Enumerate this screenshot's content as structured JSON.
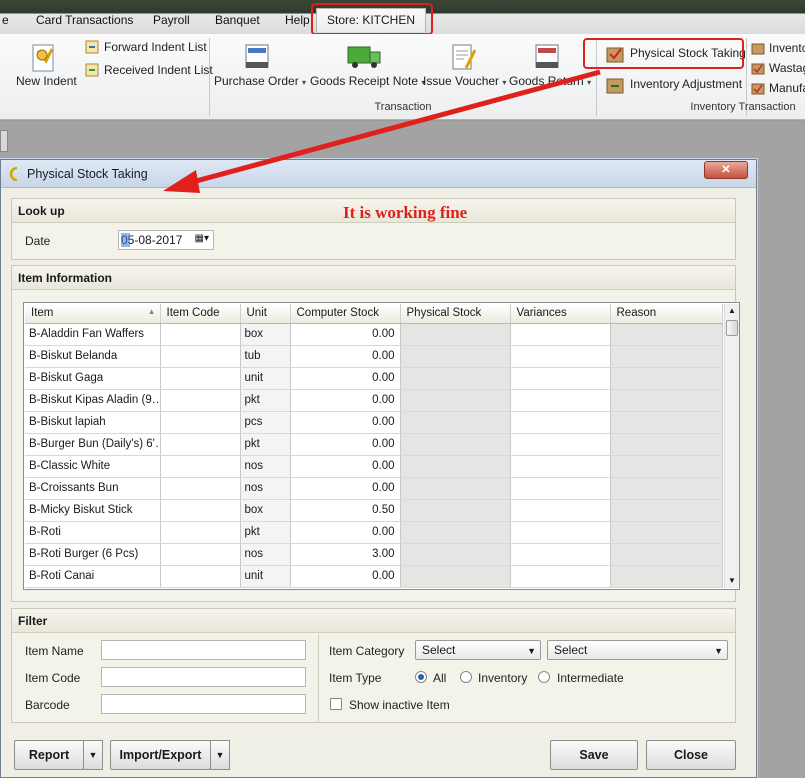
{
  "menu": {
    "tabs": [
      "e",
      "Card Transactions",
      "Payroll",
      "Banquet",
      "Help"
    ],
    "store_tab": "Store: KITCHEN"
  },
  "ribbon": {
    "new_indent": "New Indent",
    "forward_indent_list": "Forward Indent List",
    "received_indent_list": "Received Indent List",
    "purchase_order": "Purchase Order",
    "goods_receipt_note": "Goods Receipt Note",
    "issue_voucher": "Issue Voucher",
    "goods_return": "Goods Return",
    "group_transaction": "Transaction",
    "physical_stock_taking": "Physical Stock Taking",
    "inventory_adjustment": "Inventory Adjustment",
    "invento": "Invento",
    "wastag": "Wastag",
    "manufa": "Manufa",
    "group_inventory_transaction": "Inventory Transaction"
  },
  "annotation": "It is working fine",
  "dialog": {
    "title": "Physical Stock Taking",
    "lookup_title": "Look up",
    "date_label": "Date",
    "date_value": "05-08-2017",
    "item_info_title": "Item Information",
    "columns": [
      "Item",
      "Item Code",
      "Unit",
      "Computer Stock",
      "Physical Stock",
      "Variances",
      "Reason"
    ],
    "rows": [
      {
        "item": "B-Aladdin Fan Waffers",
        "code": "",
        "unit": "box",
        "stock": "0.00"
      },
      {
        "item": "B-Biskut Belanda",
        "code": "",
        "unit": "tub",
        "stock": "0.00"
      },
      {
        "item": "B-Biskut Gaga",
        "code": "",
        "unit": "unit",
        "stock": "0.00"
      },
      {
        "item": "B-Biskut Kipas Aladin (9…",
        "code": "",
        "unit": "pkt",
        "stock": "0.00"
      },
      {
        "item": "B-Biskut lapiah",
        "code": "",
        "unit": "pcs",
        "stock": "0.00"
      },
      {
        "item": "B-Burger Bun (Daily's) 6'…",
        "code": "",
        "unit": "pkt",
        "stock": "0.00"
      },
      {
        "item": "B-Classic White",
        "code": "",
        "unit": "nos",
        "stock": "0.00"
      },
      {
        "item": "B-Croissants Bun",
        "code": "",
        "unit": "nos",
        "stock": "0.00"
      },
      {
        "item": "B-Micky Biskut Stick",
        "code": "",
        "unit": "box",
        "stock": "0.50"
      },
      {
        "item": "B-Roti",
        "code": "",
        "unit": "pkt",
        "stock": "0.00"
      },
      {
        "item": "B-Roti Burger (6 Pcs)",
        "code": "",
        "unit": "nos",
        "stock": "3.00"
      },
      {
        "item": "B-Roti Canai",
        "code": "",
        "unit": "unit",
        "stock": "0.00"
      }
    ],
    "filter_title": "Filter",
    "item_name_label": "Item Name",
    "item_code_label": "Item Code",
    "barcode_label": "Barcode",
    "item_category_label": "Item Category",
    "category_select1": "Select",
    "category_select2": "Select",
    "item_type_label": "Item Type",
    "type_all": "All",
    "type_inventory": "Inventory",
    "type_intermediate": "Intermediate",
    "show_inactive": "Show inactive Item",
    "report": "Report",
    "import_export": "Import/Export",
    "save": "Save",
    "close": "Close"
  },
  "colors": {
    "highlight": "#e0201c",
    "accent": "#2a5fb8"
  }
}
